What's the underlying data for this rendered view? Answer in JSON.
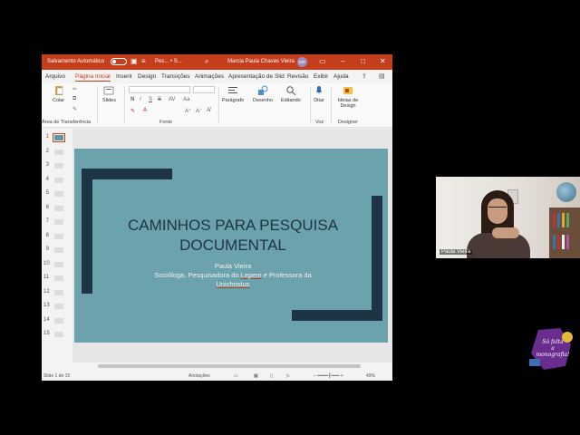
{
  "window": {
    "autosave_label": "Salvamento Automático",
    "doc_title": "Pes... • S...",
    "user_name": "Marcia Paula Chaves Vieira",
    "user_initials": "MP"
  },
  "menu": {
    "tabs": [
      "Arquivo",
      "Página Inicial",
      "Inserir",
      "Design",
      "Transições",
      "Animações",
      "Apresentação de Slides",
      "Revisão",
      "Exibir",
      "Ajuda"
    ]
  },
  "ribbon": {
    "clipboard_label": "Área de Transferência",
    "paste_label": "Colar",
    "slides_label": "Slides",
    "font_group_label": "Fonte",
    "paragraph_label": "Parágrafo",
    "drawing_label": "Desenho",
    "editing_label": "Editando",
    "dictate_label": "Ditar",
    "voice_label": "Voz",
    "design_ideas_label": "Ideias de Design",
    "designer_label": "Designer",
    "format_buttons": [
      "N",
      "I",
      "S",
      "S",
      "AV",
      "Aa"
    ]
  },
  "thumbnails": {
    "numbers": [
      "1",
      "2",
      "3",
      "4",
      "5",
      "6",
      "7",
      "8",
      "9",
      "10",
      "11",
      "12",
      "13",
      "14",
      "15"
    ]
  },
  "slide": {
    "title_line1": "CAMINHOS PARA PESQUISA",
    "title_line2": "DOCUMENTAL",
    "author": "Paula Vieira",
    "role_line1": "Socióloga, Pesquisadora do",
    "role_lepem": "Lepem",
    "role_line1_end": "e Professora da",
    "institution": "Unichristus"
  },
  "status": {
    "slide_counter": "Slide 1 de 15",
    "notes_label": "Anotações",
    "zoom": "49%"
  },
  "webcam": {
    "participant_name": "Paula Vieira"
  },
  "logo": {
    "line1": "Só falta",
    "line2": "a",
    "line3": "monografia!"
  },
  "colors": {
    "title_bar": "#c43e1c",
    "slide_background": "#6ba2ab",
    "slide_dark": "#1d3444",
    "logo_purple": "#6a2c8f",
    "logo_gold": "#e6b93b"
  }
}
